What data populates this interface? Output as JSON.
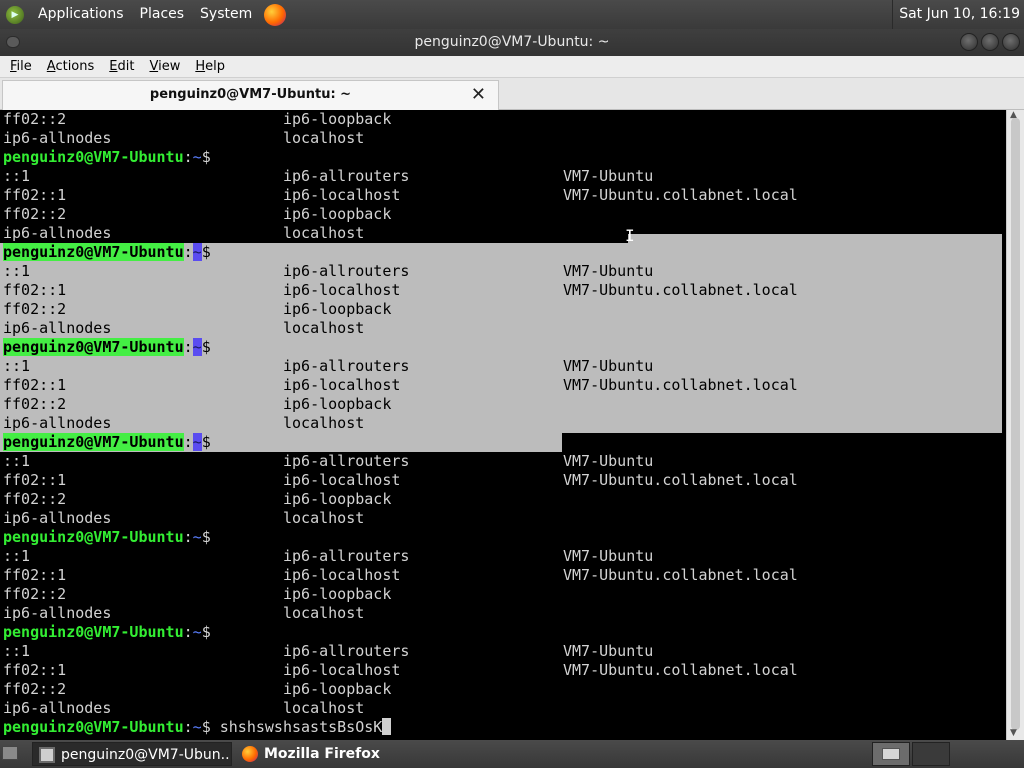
{
  "top_panel": {
    "menus": [
      "Applications",
      "Places",
      "System"
    ],
    "clock": "Sat Jun 10, 16:19"
  },
  "window": {
    "title": "penguinz0@VM7-Ubuntu: ~"
  },
  "menubar": {
    "items": [
      {
        "mnemonic": "F",
        "rest": "ile"
      },
      {
        "mnemonic": "A",
        "rest": "ctions"
      },
      {
        "mnemonic": "E",
        "rest": "dit"
      },
      {
        "mnemonic": "V",
        "rest": "iew"
      },
      {
        "mnemonic": "H",
        "rest": "elp"
      }
    ]
  },
  "tab": {
    "label": "penguinz0@VM7-Ubuntu: ~",
    "close": "✕"
  },
  "terminal": {
    "prompt_user": "penguinz0@VM7-Ubuntu",
    "prompt_sep": ":",
    "prompt_dir": "~",
    "prompt_end": "$",
    "current_input": " shshswshsastsBsOsK",
    "lines": [
      {
        "type": "out",
        "cols": [
          "ff02::2",
          "ip6-loopback",
          ""
        ]
      },
      {
        "type": "out",
        "cols": [
          "ip6-allnodes",
          "localhost",
          ""
        ]
      },
      {
        "type": "prompt"
      },
      {
        "type": "out",
        "cols": [
          "::1",
          "ip6-allrouters",
          "VM7-Ubuntu"
        ]
      },
      {
        "type": "out",
        "cols": [
          "ff02::1",
          "ip6-localhost",
          "VM7-Ubuntu.collabnet.local"
        ]
      },
      {
        "type": "out",
        "cols": [
          "ff02::2",
          "ip6-loopback",
          ""
        ]
      },
      {
        "type": "out",
        "cols": [
          "ip6-allnodes",
          "localhost",
          ""
        ]
      },
      {
        "type": "prompt",
        "selected": true
      },
      {
        "type": "out",
        "cols": [
          "::1",
          "ip6-allrouters",
          "VM7-Ubuntu"
        ],
        "selected": true
      },
      {
        "type": "out",
        "cols": [
          "ff02::1",
          "ip6-localhost",
          "VM7-Ubuntu.collabnet.local"
        ],
        "selected": true
      },
      {
        "type": "out",
        "cols": [
          "ff02::2",
          "ip6-loopback",
          ""
        ],
        "selected": true
      },
      {
        "type": "out",
        "cols": [
          "ip6-allnodes",
          "localhost",
          ""
        ],
        "selected": true
      },
      {
        "type": "prompt",
        "selected": true
      },
      {
        "type": "out",
        "cols": [
          "::1",
          "ip6-allrouters",
          "VM7-Ubuntu"
        ],
        "selected": true
      },
      {
        "type": "out",
        "cols": [
          "ff02::1",
          "ip6-localhost",
          "VM7-Ubuntu.collabnet.local"
        ],
        "selected": true
      },
      {
        "type": "out",
        "cols": [
          "ff02::2",
          "ip6-loopback",
          ""
        ],
        "selected": true
      },
      {
        "type": "out",
        "cols": [
          "ip6-allnodes",
          "localhost",
          ""
        ],
        "selected": true
      },
      {
        "type": "prompt",
        "selected": true
      },
      {
        "type": "out",
        "cols": [
          "::1",
          "ip6-allrouters",
          "VM7-Ubuntu"
        ]
      },
      {
        "type": "out",
        "cols": [
          "ff02::1",
          "ip6-localhost",
          "VM7-Ubuntu.collabnet.local"
        ]
      },
      {
        "type": "out",
        "cols": [
          "ff02::2",
          "ip6-loopback",
          ""
        ]
      },
      {
        "type": "out",
        "cols": [
          "ip6-allnodes",
          "localhost",
          ""
        ]
      },
      {
        "type": "prompt"
      },
      {
        "type": "out",
        "cols": [
          "::1",
          "ip6-allrouters",
          "VM7-Ubuntu"
        ]
      },
      {
        "type": "out",
        "cols": [
          "ff02::1",
          "ip6-localhost",
          "VM7-Ubuntu.collabnet.local"
        ]
      },
      {
        "type": "out",
        "cols": [
          "ff02::2",
          "ip6-loopback",
          ""
        ]
      },
      {
        "type": "out",
        "cols": [
          "ip6-allnodes",
          "localhost",
          ""
        ]
      },
      {
        "type": "prompt"
      },
      {
        "type": "out",
        "cols": [
          "::1",
          "ip6-allrouters",
          "VM7-Ubuntu"
        ]
      },
      {
        "type": "out",
        "cols": [
          "ff02::1",
          "ip6-localhost",
          "VM7-Ubuntu.collabnet.local"
        ]
      },
      {
        "type": "out",
        "cols": [
          "ff02::2",
          "ip6-loopback",
          ""
        ]
      },
      {
        "type": "out",
        "cols": [
          "ip6-allnodes",
          "localhost",
          ""
        ]
      },
      {
        "type": "input"
      }
    ]
  },
  "taskbar": {
    "tasks": [
      {
        "label": "penguinz0@VM7-Ubun...",
        "icon": "terminal-icon",
        "active": true
      },
      {
        "label": "Mozilla Firefox",
        "icon": "firefox-icon",
        "active": false
      }
    ]
  },
  "colors": {
    "terminal_bg": "#000000",
    "terminal_fg": "#d3d3d3",
    "prompt_user": "#33ee33",
    "prompt_dir": "#5b7fff",
    "selection": "#bcbcbc"
  }
}
